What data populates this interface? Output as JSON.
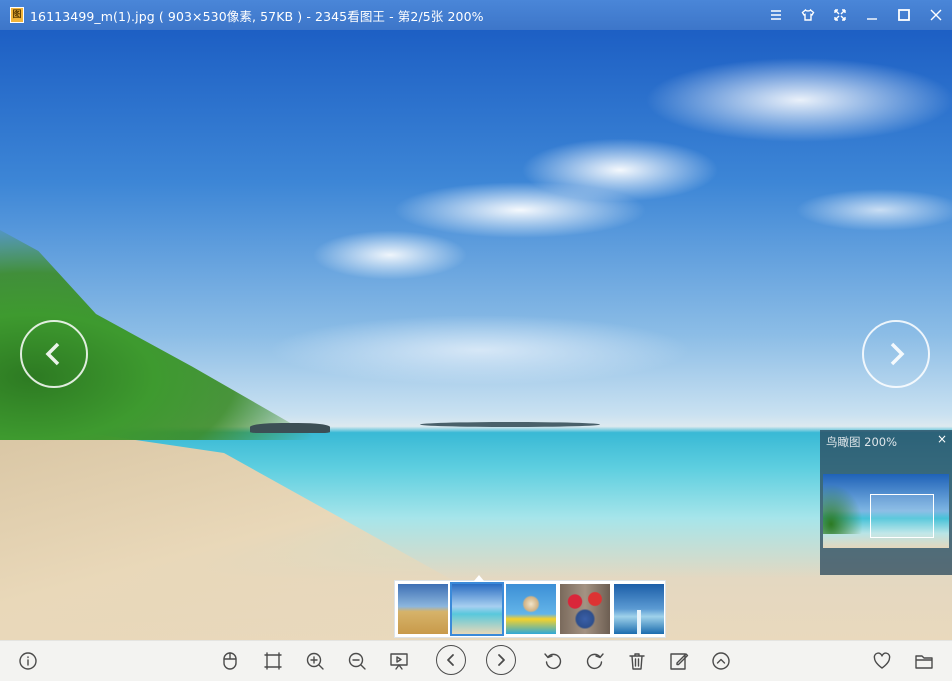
{
  "window": {
    "title": "16113499_m(1).jpg ( 903×530像素, 57KB ) - 2345看图王 - 第2/5张 200%",
    "app_icon": "app-icon",
    "controls": [
      "menu-icon",
      "skin-icon",
      "fullscreen-icon",
      "minimize-icon",
      "maximize-icon",
      "close-icon"
    ]
  },
  "viewer": {
    "image_subject": "tropical beach",
    "prev_icon": "chevron-left-icon",
    "next_icon": "chevron-right-icon"
  },
  "birdseye": {
    "title": "鸟瞰图 200%",
    "close_label": "×"
  },
  "filmstrip": {
    "selected_index": 2,
    "thumbnails": [
      "wheat-field",
      "beach",
      "dog-on-raft",
      "strawberries-blueberries",
      "pier-at-sea"
    ]
  },
  "toolbar": {
    "left": [
      "info-icon"
    ],
    "center": [
      "mouse-icon",
      "fit-screen-icon",
      "zoom-in-icon",
      "zoom-out-icon",
      "slideshow-icon",
      "previous-icon",
      "next-icon",
      "rotate-left-icon",
      "rotate-right-icon",
      "delete-icon",
      "edit-icon",
      "more-icon"
    ],
    "right": [
      "favorite-icon",
      "open-folder-icon"
    ]
  },
  "colors": {
    "titlebar": "#4a86d8",
    "toolbar": "#f3f3f1",
    "selection": "#3b8ad9"
  }
}
